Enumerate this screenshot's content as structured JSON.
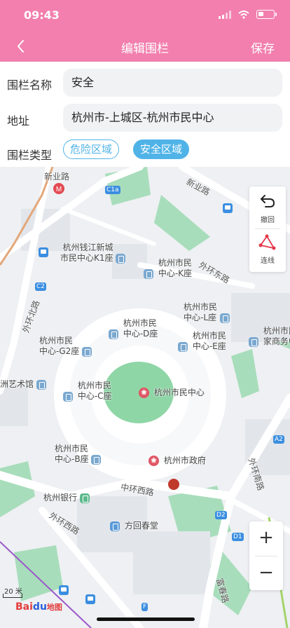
{
  "status": {
    "time": "09:43"
  },
  "header": {
    "title": "编辑围栏",
    "save_label": "保存"
  },
  "form": {
    "name_label": "围栏名称",
    "name_value": "安全",
    "address_label": "地址",
    "address_value": "杭州市-上城区-杭州市民中心",
    "type_label": "围栏类型",
    "type_options": [
      "危险区域",
      "安全区域"
    ],
    "selected_type": "安全区域"
  },
  "map": {
    "tools": {
      "undo_label": "撤回",
      "connect_label": "连线"
    },
    "zoom": {
      "in_label": "+",
      "out_label": "−"
    },
    "scale_label": "20 米",
    "logo": {
      "red": "Bai",
      "blue": "du",
      "suffix": "地图"
    },
    "pois": {
      "k1": "杭州钱江新城\n市民中心K1座",
      "k": "杭州市民\n中心-K座",
      "l": "杭州市民\n中心-L座",
      "d": "杭州市民\n中心-D座",
      "g2": "杭州市民\n中心-G2座",
      "e": "杭州市民\n中心-E座",
      "family": "杭州市民\n家商务中",
      "art": "洲艺术馆",
      "c": "杭州市民\n中心-C座",
      "center": "杭州市民中心",
      "b": "杭州市民\n中心-B座",
      "gov": "杭州市政府",
      "bank": "杭州银行",
      "fang": "方回春堂"
    },
    "roads": {
      "xinye_west": "新业路",
      "xinye": "新业路",
      "waihuan_east": "外环东路",
      "waihuan_north": "外环北路",
      "zhonghuan_west": "中环西路",
      "waihuan_west": "外环西路",
      "waihuan_south": "外环南路",
      "fuchun": "富春路"
    },
    "tags": {
      "c1a": "C1a",
      "c2": "C2",
      "a2": "A2",
      "d2": "D2",
      "d1": "D1",
      "f": "F"
    }
  },
  "colors": {
    "header": "#f27fae",
    "accent": "#4fb3e8",
    "poi_star": "#e05462"
  }
}
